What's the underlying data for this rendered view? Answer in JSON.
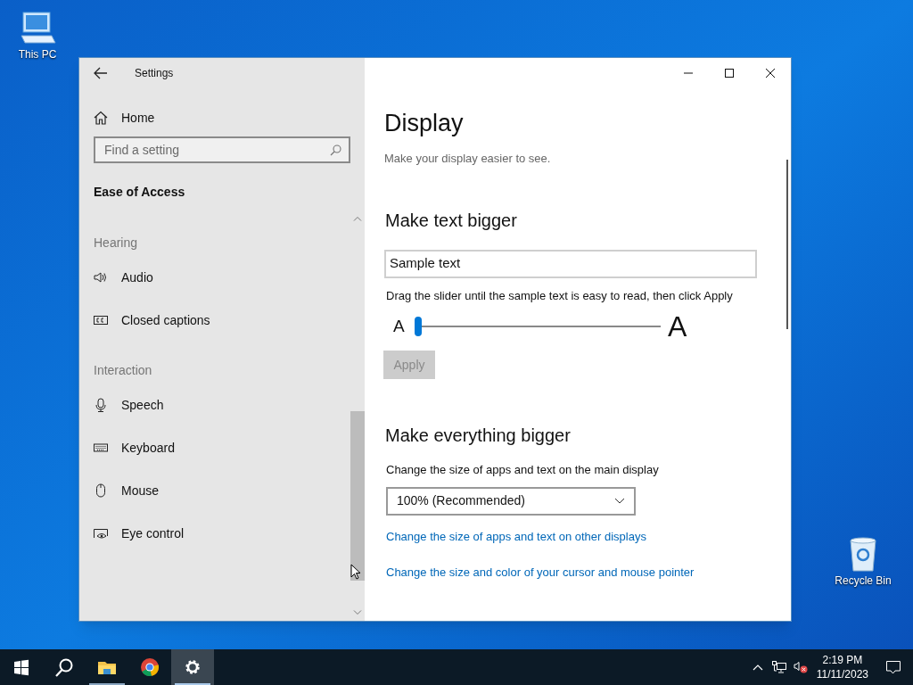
{
  "desktop_icons": [
    {
      "label": "This PC"
    },
    {
      "label": "Recycle Bin"
    }
  ],
  "window": {
    "title": "Settings"
  },
  "sidebar": {
    "home": "Home",
    "search": {
      "placeholder": "Find a setting"
    },
    "section_title": "Ease of Access",
    "groups": [
      {
        "heading": "Hearing",
        "items": [
          {
            "label": "Audio"
          },
          {
            "label": "Closed captions"
          }
        ]
      },
      {
        "heading": "Interaction",
        "items": [
          {
            "label": "Speech"
          },
          {
            "label": "Keyboard"
          },
          {
            "label": "Mouse"
          },
          {
            "label": "Eye control"
          }
        ]
      }
    ]
  },
  "content": {
    "title": "Display",
    "subtitle": "Make your display easier to see.",
    "text_section": {
      "heading": "Make text bigger",
      "sample": "Sample text",
      "instruction": "Drag the slider until the sample text is easy to read, then click Apply",
      "small_label": "A",
      "large_label": "A",
      "level": 0,
      "apply": {
        "label": "Apply",
        "disabled": true
      }
    },
    "scale_section": {
      "heading": "Make everything bigger",
      "label": "Change the size of apps and text on the main display",
      "dropdown": "100% (Recommended)",
      "links": [
        "Change the size of apps and text on other displays",
        "Change the size and color of your cursor and mouse pointer"
      ]
    }
  },
  "taskbar": {
    "apps": [
      {
        "kind": "start",
        "open": false,
        "selected": false
      },
      {
        "kind": "search",
        "open": false,
        "selected": false
      },
      {
        "kind": "explorer",
        "open": true,
        "selected": false
      },
      {
        "kind": "browser",
        "open": false,
        "selected": false
      },
      {
        "kind": "settings",
        "open": true,
        "selected": true
      }
    ],
    "time": "2:19 PM",
    "date": "11/11/2023"
  }
}
